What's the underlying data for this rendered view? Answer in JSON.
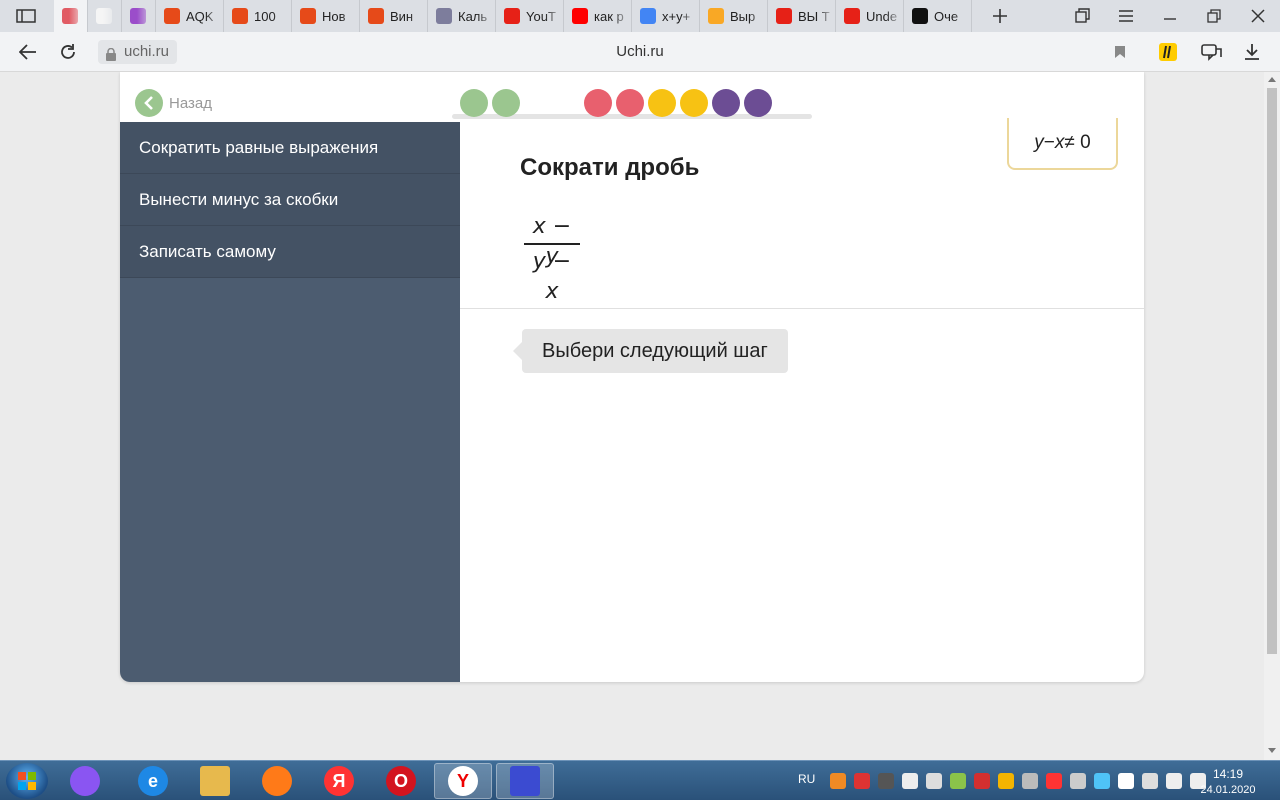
{
  "browser": {
    "tabs": [
      {
        "label": "",
        "favicon": "uchi-icon",
        "color": "#e15b64",
        "active": true
      },
      {
        "label": "",
        "favicon": "blank-page-icon",
        "color": "#f5f5f5",
        "active": false
      },
      {
        "label": "",
        "favicon": "flask-icon",
        "color": "#9b4dca",
        "active": false
      },
      {
        "label": "AQK",
        "favicon": "shop-bag-icon",
        "color": "#e64a19",
        "active": false
      },
      {
        "label": "100",
        "favicon": "shop-bag-icon",
        "color": "#e64a19",
        "active": false
      },
      {
        "label": "Нов",
        "favicon": "shop-bag-icon",
        "color": "#e64a19",
        "active": false
      },
      {
        "label": "Вин",
        "favicon": "shop-bag-icon",
        "color": "#e64a19",
        "active": false
      },
      {
        "label": "Каль",
        "favicon": "calculator-icon",
        "color": "#7d7d9c",
        "active": false
      },
      {
        "label": "YouT",
        "favicon": "youtube-icon",
        "color": "#e62117",
        "active": false
      },
      {
        "label": "как р",
        "favicon": "yandex-icon",
        "color": "#ff0000",
        "active": false
      },
      {
        "label": "x+y+",
        "favicon": "google-icon",
        "color": "#4285f4",
        "active": false
      },
      {
        "label": "Выр",
        "favicon": "orange-circle-icon",
        "color": "#f9a825",
        "active": false
      },
      {
        "label": "ВЫ Т",
        "favicon": "youtube-icon",
        "color": "#e62117",
        "active": false
      },
      {
        "label": "Unde",
        "favicon": "youtube-icon",
        "color": "#e62117",
        "active": false
      },
      {
        "label": "Оче",
        "favicon": "z-icon",
        "color": "#111111",
        "active": false
      }
    ],
    "url": "uchi.ru",
    "page_title": "Uchi.ru"
  },
  "page": {
    "back_label": "Назад",
    "progress_dots": [
      {
        "color": "#9bc68f",
        "gap": false
      },
      {
        "color": "#9bc68f",
        "gap": false
      },
      {
        "color": "#e8606e",
        "gap": true
      },
      {
        "color": "#e8606e",
        "gap": false
      },
      {
        "color": "#f7c213",
        "gap": false
      },
      {
        "color": "#f7c213",
        "gap": false
      },
      {
        "color": "#6c4d94",
        "gap": false
      },
      {
        "color": "#6c4d94",
        "gap": false
      }
    ],
    "sidebar_items": [
      "Сократить равные выражения",
      "Вынести минус за скобки",
      "Записать самому"
    ],
    "task_title": "Сократи дробь",
    "fraction_numerator": "x − y",
    "fraction_denominator": "y − x",
    "condition": {
      "left": "y",
      "op": " − ",
      "var": "x",
      "rel": " ≠ 0"
    },
    "hint": "Выбери следующий шаг"
  },
  "taskbar": {
    "apps": [
      {
        "name": "alice-icon",
        "color": "#8a55f2",
        "glyph": "",
        "active": false
      },
      {
        "name": "ie-icon",
        "color": "#1e88e5",
        "glyph": "e",
        "active": false
      },
      {
        "name": "explorer-icon",
        "color": "#e7b94d",
        "glyph": "",
        "active": false
      },
      {
        "name": "firefox-icon",
        "color": "#ff7a18",
        "glyph": "",
        "active": false
      },
      {
        "name": "yandex-browser-icon",
        "color": "#ff3333",
        "glyph": "Я",
        "active": false
      },
      {
        "name": "opera-icon",
        "color": "#d3141f",
        "glyph": "O",
        "active": false
      },
      {
        "name": "yandex-icon",
        "color": "#ffffff",
        "glyph": "Y",
        "active": true
      },
      {
        "name": "save-disk-icon",
        "color": "#3b4bd1",
        "glyph": "",
        "active": true
      }
    ],
    "language": "RU",
    "tray_icons": [
      "#f08a24",
      "#d33",
      "#555",
      "#eee",
      "#ddd",
      "#8bc34a",
      "#d32f2f",
      "#f4b400",
      "#bbb",
      "#ff3333",
      "#ccc",
      "#4fc3f7",
      "#fff",
      "#ddd",
      "#eee",
      "#eee"
    ],
    "time": "14:19",
    "date": "24.01.2020"
  }
}
